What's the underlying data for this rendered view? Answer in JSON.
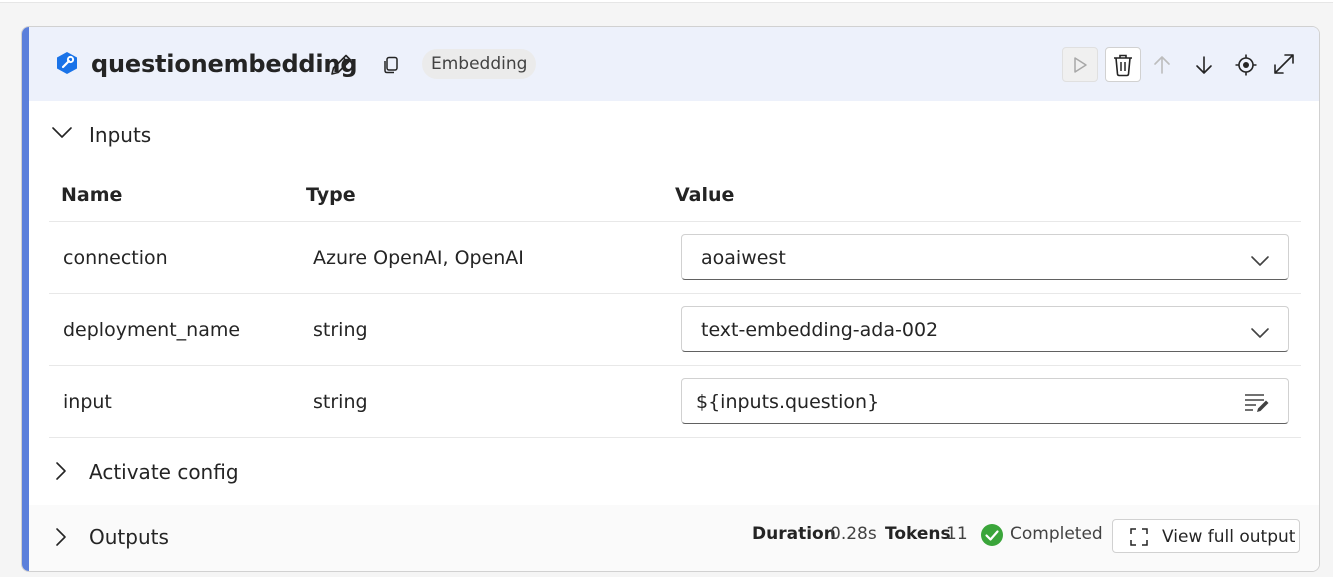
{
  "colors": {
    "accent": "#5b7fdb",
    "header_bg": "#edf1fb",
    "icon_blue": "#1a73e8",
    "success": "#3aa53a",
    "pill_bg": "#ebebeb",
    "disabled": "#a8a8a8"
  },
  "node": {
    "title": "questionembedding",
    "type_pill": "Embedding",
    "icons": [
      "python-tool-icon",
      "edit-pencil-icon",
      "copy-icon",
      "run-play-icon",
      "delete-trash-icon",
      "move-up-arrow-icon",
      "move-down-arrow-icon",
      "locate-target-icon",
      "expand-icon"
    ]
  },
  "inputs": {
    "section_label": "Inputs",
    "columns": {
      "name": "Name",
      "type": "Type",
      "value": "Value"
    },
    "rows": [
      {
        "name": "connection",
        "type": "Azure OpenAI, OpenAI",
        "value": "aoaiwest",
        "control": "dropdown"
      },
      {
        "name": "deployment_name",
        "type": "string",
        "value": "text-embedding-ada-002",
        "control": "dropdown"
      },
      {
        "name": "input",
        "type": "string",
        "value": "${inputs.question}",
        "control": "text-edit"
      }
    ]
  },
  "activate_config": {
    "section_label": "Activate config"
  },
  "outputs": {
    "section_label": "Outputs",
    "duration_label": "Duration",
    "duration_value": "0.28s",
    "tokens_label": "Tokens",
    "tokens_value": "11",
    "status": "Completed",
    "view_button": "View full output"
  }
}
